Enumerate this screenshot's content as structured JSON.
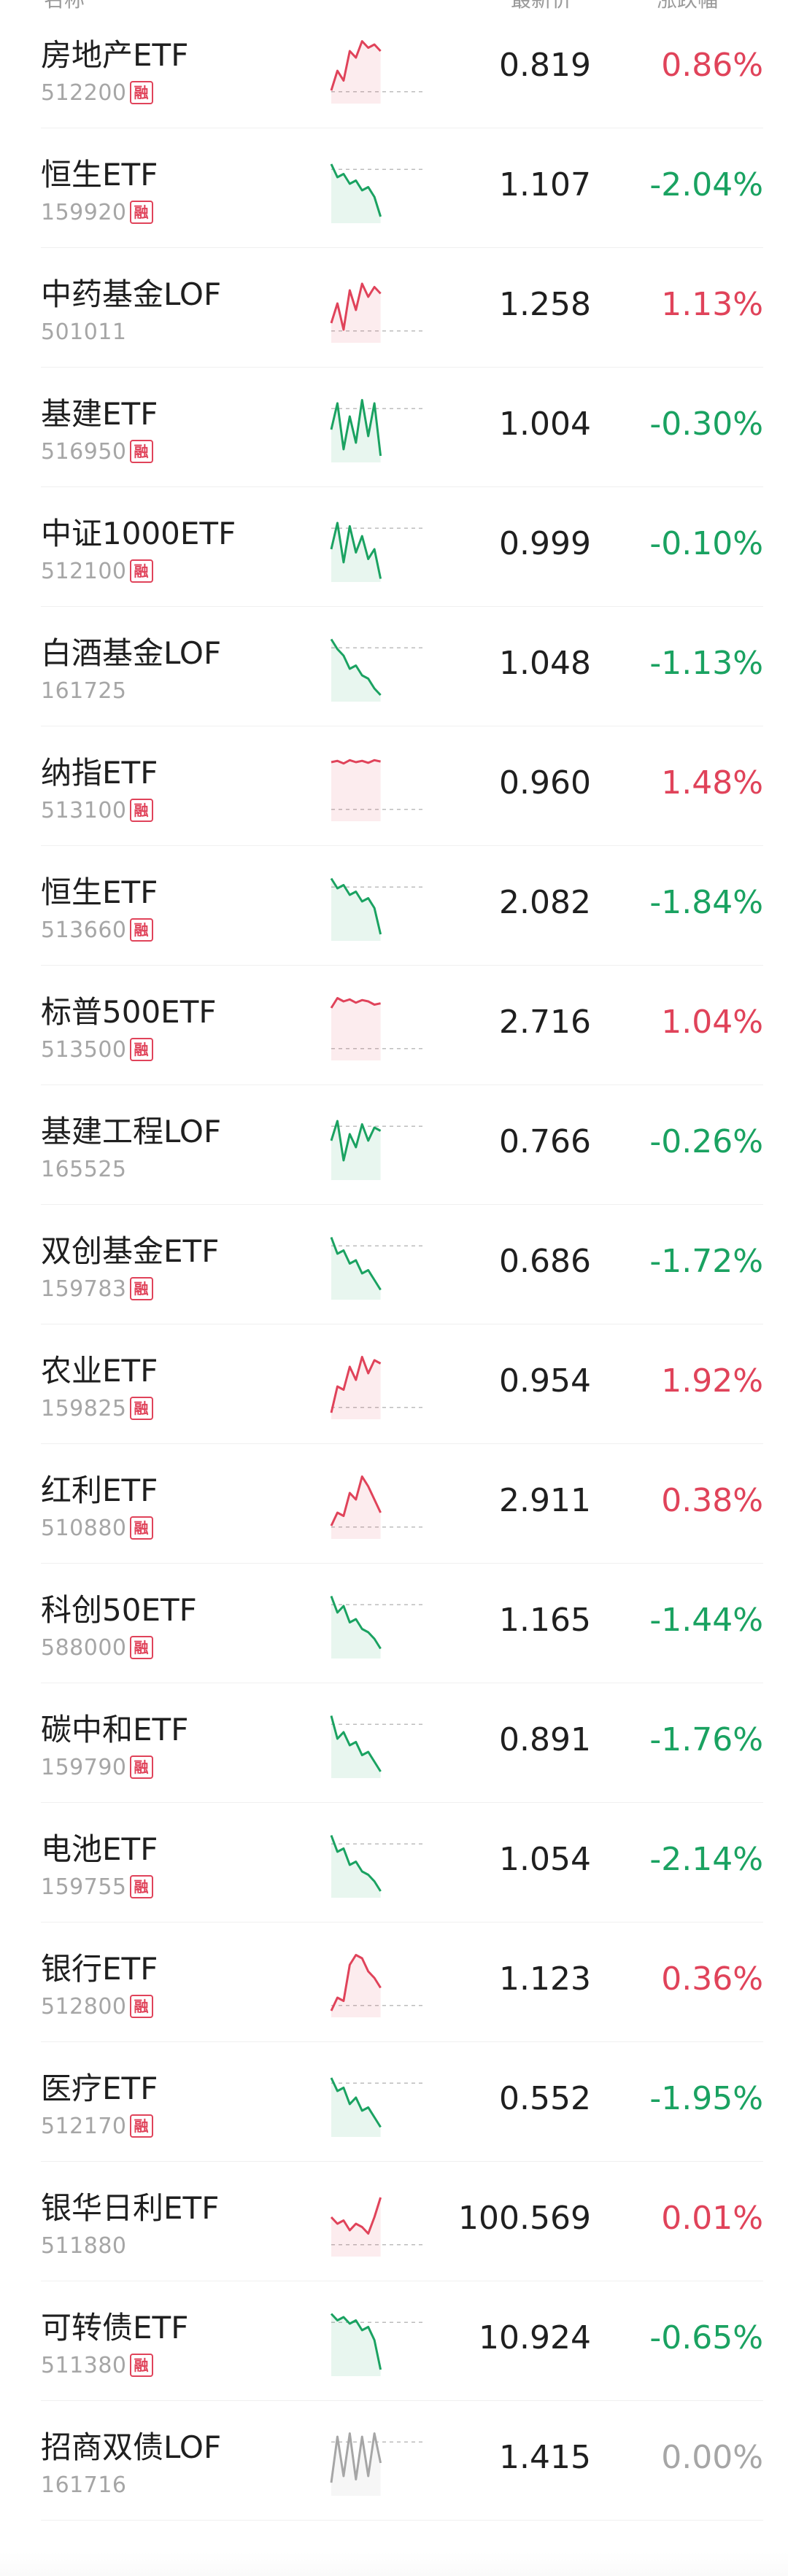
{
  "header": {
    "col_name": "名称",
    "col_price": "最新价",
    "col_change": "涨跌幅"
  },
  "colors": {
    "up": "#e0435a",
    "down": "#1aa261",
    "flat": "#a6a6a6"
  },
  "rows": [
    {
      "name": "房地产ETF",
      "code": "512200",
      "margin": "融",
      "price": "0.819",
      "change": "0.86%",
      "trend": "up",
      "spark": [
        0.2,
        0.5,
        0.35,
        0.8,
        0.7,
        0.95,
        0.85,
        0.9,
        0.8
      ]
    },
    {
      "name": "恒生ETF",
      "code": "159920",
      "margin": "融",
      "price": "1.107",
      "change": "-2.04%",
      "trend": "down",
      "spark": [
        0.9,
        0.7,
        0.75,
        0.6,
        0.65,
        0.5,
        0.55,
        0.4,
        0.1
      ]
    },
    {
      "name": "中药基金LOF",
      "code": "501011",
      "margin": "",
      "price": "1.258",
      "change": "1.13%",
      "trend": "up",
      "spark": [
        0.3,
        0.6,
        0.2,
        0.8,
        0.5,
        0.9,
        0.7,
        0.85,
        0.75
      ]
    },
    {
      "name": "基建ETF",
      "code": "516950",
      "margin": "融",
      "price": "1.004",
      "change": "-0.30%",
      "trend": "down",
      "spark": [
        0.5,
        0.9,
        0.2,
        0.7,
        0.3,
        0.95,
        0.4,
        0.9,
        0.1
      ]
    },
    {
      "name": "中证1000ETF",
      "code": "512100",
      "margin": "融",
      "price": "0.999",
      "change": "-0.10%",
      "trend": "down",
      "spark": [
        0.5,
        0.9,
        0.3,
        0.85,
        0.45,
        0.7,
        0.35,
        0.5,
        0.05
      ]
    },
    {
      "name": "白酒基金LOF",
      "code": "161725",
      "margin": "",
      "price": "1.048",
      "change": "-1.13%",
      "trend": "down",
      "spark": [
        0.95,
        0.8,
        0.7,
        0.5,
        0.55,
        0.4,
        0.35,
        0.2,
        0.1
      ]
    },
    {
      "name": "纳指ETF",
      "code": "513100",
      "margin": "融",
      "price": "0.960",
      "change": "1.48%",
      "trend": "up",
      "spark": [
        0.9,
        0.92,
        0.88,
        0.93,
        0.9,
        0.92,
        0.89,
        0.93,
        0.91
      ]
    },
    {
      "name": "恒生ETF",
      "code": "513660",
      "margin": "融",
      "price": "2.082",
      "change": "-1.84%",
      "trend": "down",
      "spark": [
        0.95,
        0.8,
        0.85,
        0.7,
        0.75,
        0.6,
        0.65,
        0.5,
        0.1
      ]
    },
    {
      "name": "标普500ETF",
      "code": "513500",
      "margin": "融",
      "price": "2.716",
      "change": "1.04%",
      "trend": "up",
      "spark": [
        0.8,
        0.95,
        0.9,
        0.93,
        0.88,
        0.92,
        0.9,
        0.85,
        0.87
      ]
    },
    {
      "name": "基建工程LOF",
      "code": "165525",
      "margin": "",
      "price": "0.766",
      "change": "-0.26%",
      "trend": "down",
      "spark": [
        0.6,
        0.9,
        0.3,
        0.7,
        0.5,
        0.85,
        0.6,
        0.8,
        0.75
      ]
    },
    {
      "name": "双创基金ETF",
      "code": "159783",
      "margin": "融",
      "price": "0.686",
      "change": "-1.72%",
      "trend": "down",
      "spark": [
        0.95,
        0.7,
        0.75,
        0.55,
        0.6,
        0.4,
        0.45,
        0.3,
        0.15
      ]
    },
    {
      "name": "农业ETF",
      "code": "159825",
      "margin": "融",
      "price": "0.954",
      "change": "1.92%",
      "trend": "up",
      "spark": [
        0.1,
        0.5,
        0.45,
        0.8,
        0.6,
        0.95,
        0.7,
        0.9,
        0.85
      ]
    },
    {
      "name": "红利ETF",
      "code": "510880",
      "margin": "融",
      "price": "2.911",
      "change": "0.38%",
      "trend": "up",
      "spark": [
        0.2,
        0.4,
        0.35,
        0.7,
        0.6,
        0.95,
        0.8,
        0.6,
        0.4
      ]
    },
    {
      "name": "科创50ETF",
      "code": "588000",
      "margin": "融",
      "price": "1.165",
      "change": "-1.44%",
      "trend": "down",
      "spark": [
        0.95,
        0.7,
        0.8,
        0.55,
        0.6,
        0.45,
        0.4,
        0.3,
        0.15
      ]
    },
    {
      "name": "碳中和ETF",
      "code": "159790",
      "margin": "融",
      "price": "0.891",
      "change": "-1.76%",
      "trend": "down",
      "spark": [
        0.95,
        0.6,
        0.7,
        0.5,
        0.55,
        0.35,
        0.4,
        0.25,
        0.1
      ]
    },
    {
      "name": "电池ETF",
      "code": "159755",
      "margin": "融",
      "price": "1.054",
      "change": "-2.14%",
      "trend": "down",
      "spark": [
        0.95,
        0.7,
        0.75,
        0.5,
        0.55,
        0.4,
        0.35,
        0.25,
        0.1
      ]
    },
    {
      "name": "银行ETF",
      "code": "512800",
      "margin": "融",
      "price": "1.123",
      "change": "0.36%",
      "trend": "up",
      "spark": [
        0.1,
        0.3,
        0.25,
        0.8,
        0.95,
        0.9,
        0.7,
        0.6,
        0.45
      ]
    },
    {
      "name": "医疗ETF",
      "code": "512170",
      "margin": "融",
      "price": "0.552",
      "change": "-1.95%",
      "trend": "down",
      "spark": [
        0.9,
        0.7,
        0.75,
        0.5,
        0.6,
        0.4,
        0.45,
        0.3,
        0.15
      ]
    },
    {
      "name": "银华日利ETF",
      "code": "511880",
      "margin": "",
      "price": "100.569",
      "change": "0.01%",
      "trend": "up",
      "spark": [
        0.6,
        0.5,
        0.55,
        0.4,
        0.5,
        0.45,
        0.35,
        0.6,
        0.9
      ]
    },
    {
      "name": "可转债ETF",
      "code": "511380",
      "margin": "融",
      "price": "10.924",
      "change": "-0.65%",
      "trend": "down",
      "spark": [
        0.95,
        0.85,
        0.9,
        0.8,
        0.85,
        0.7,
        0.75,
        0.55,
        0.1
      ]
    },
    {
      "name": "招商双债LOF",
      "code": "161716",
      "margin": "",
      "price": "1.415",
      "change": "0.00%",
      "trend": "flat",
      "spark": [
        0.2,
        0.9,
        0.3,
        0.95,
        0.25,
        0.9,
        0.3,
        0.95,
        0.5
      ]
    }
  ]
}
